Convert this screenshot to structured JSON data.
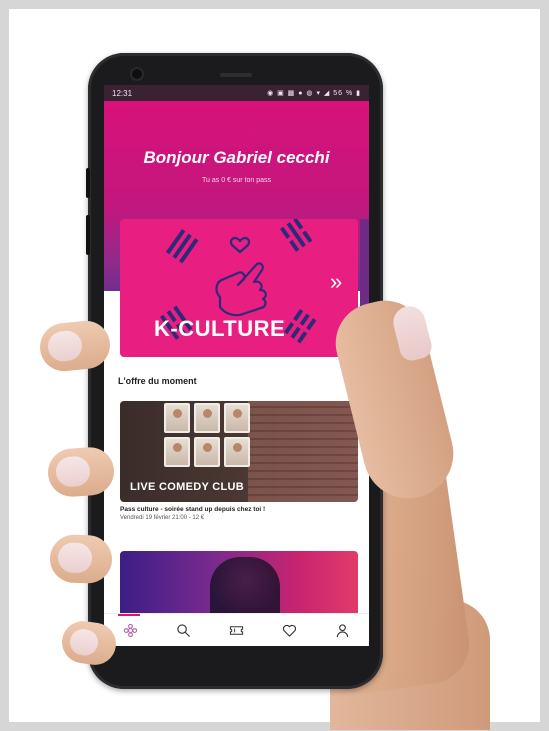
{
  "status_bar": {
    "time": "12:31",
    "icons_text": "◉ ▣ ▩ ● ◍ ▾ ◢ 56 % ▮"
  },
  "header": {
    "greeting": "Bonjour Gabriel cecchi",
    "pass_info": "Tu as 0 € sur ton pass"
  },
  "banner": {
    "title": "K-CULTURE",
    "next_icon": "chevron-double-right-icon"
  },
  "section": {
    "title": "L'offre du moment"
  },
  "offer_card": {
    "image_title": "LIVE COMEDY CLUB",
    "caption": "Pass culture - soirée stand up depuis chez toi !",
    "meta": "Vendredi 19 février 21:00 - 12 €"
  },
  "tabbar": {
    "items": [
      {
        "name": "home",
        "icon": "home-flower-icon",
        "active": true
      },
      {
        "name": "search",
        "icon": "search-icon"
      },
      {
        "name": "bookings",
        "icon": "ticket-icon"
      },
      {
        "name": "favorites",
        "icon": "heart-icon"
      },
      {
        "name": "profile",
        "icon": "user-icon"
      }
    ]
  },
  "colors": {
    "brand_pink": "#d8127a",
    "brand_purple": "#6f2f8e",
    "banner_pink": "#e81f80",
    "accent_navy": "#2d2a7a"
  }
}
